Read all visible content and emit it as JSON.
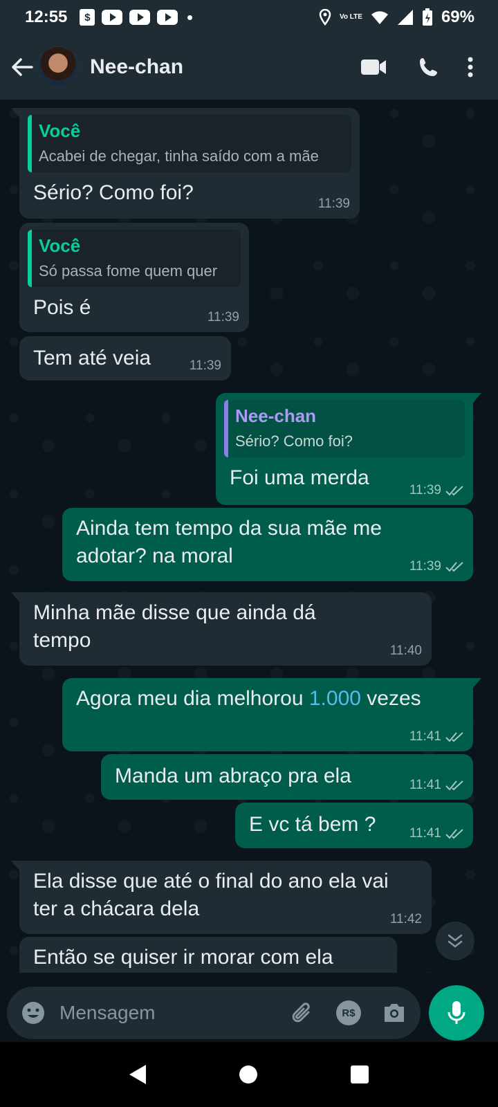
{
  "status_bar": {
    "time": "12:55",
    "network": "Vo LTE",
    "battery": "69%"
  },
  "header": {
    "contact_name": "Nee-chan"
  },
  "messages": [
    {
      "direction": "in",
      "quote_author": "Você",
      "quote_text": "Acabei de chegar, tinha saído com a mãe",
      "text": "Sério? Como foi?",
      "time": "11:39"
    },
    {
      "direction": "in",
      "quote_author": "Você",
      "quote_text": "Só passa fome quem quer",
      "text": "Pois é",
      "time": "11:39"
    },
    {
      "direction": "in",
      "text": "Tem até veia",
      "time": "11:39"
    },
    {
      "direction": "out",
      "quote_author": "Nee-chan",
      "quote_text": "Sério? Como foi?",
      "text": "Foi uma merda",
      "time": "11:39",
      "status": "read"
    },
    {
      "direction": "out",
      "text": "Ainda tem tempo da sua mãe me adotar?  na moral",
      "time": "11:39",
      "status": "read"
    },
    {
      "direction": "in",
      "text": "Minha mãe disse que ainda dá tempo",
      "time": "11:40"
    },
    {
      "direction": "out",
      "text_before": "Agora meu dia melhorou ",
      "text_link": "1.000",
      "text_after": " vezes",
      "time": "11:41",
      "status": "read"
    },
    {
      "direction": "out",
      "text": "Manda um abraço pra ela",
      "time": "11:41",
      "status": "read"
    },
    {
      "direction": "out",
      "text": "E vc tá bem ?",
      "time": "11:41",
      "status": "read"
    },
    {
      "direction": "in",
      "text": "Ela disse que até o final do ano ela vai ter a chácara dela",
      "time": "11:42"
    },
    {
      "direction": "in",
      "text": "Então se quiser ir morar com ela",
      "time": ""
    }
  ],
  "input": {
    "placeholder": "Mensagem"
  },
  "icons": {
    "header": [
      "back-arrow-icon",
      "video-call-icon",
      "voice-call-icon",
      "more-options-icon"
    ],
    "input": [
      "emoji-icon",
      "attach-icon",
      "payment-icon",
      "camera-icon",
      "mic-icon"
    ],
    "read_receipt": "double-check-icon"
  },
  "colors": {
    "header_bg": "#1f2c34",
    "chat_bg": "#0b141a",
    "incoming_bubble": "#202c33",
    "outgoing_bubble": "#005c4b",
    "accent": "#00a884",
    "link": "#53bdeb"
  }
}
